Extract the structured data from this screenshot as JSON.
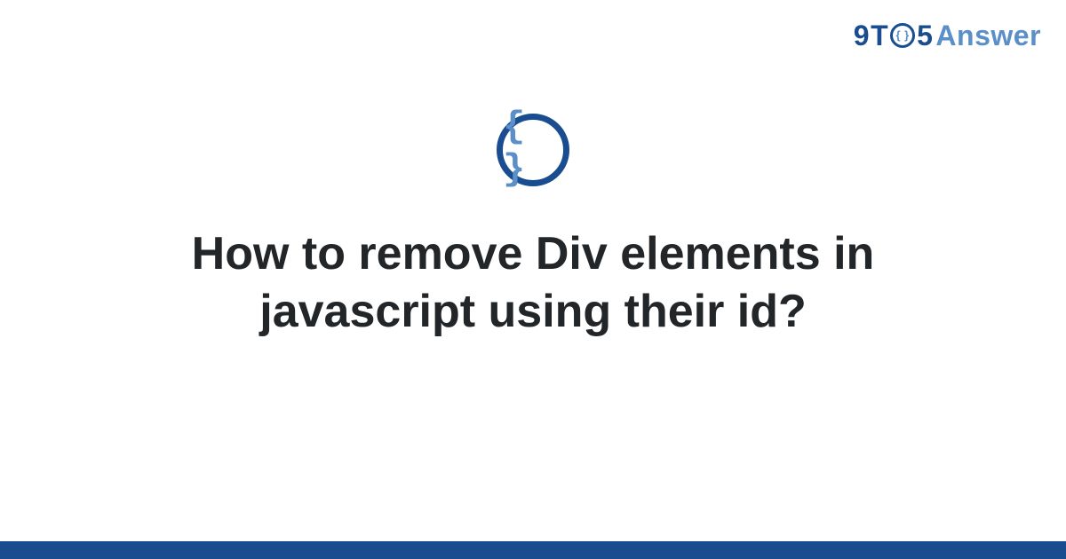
{
  "logo": {
    "nine": "9",
    "t": "T",
    "o_inner": "{ }",
    "five": "5",
    "answer": "Answer"
  },
  "icon": {
    "braces": "{ }"
  },
  "title": "How to remove Div elements in javascript using their id?",
  "colors": {
    "primary": "#1a4d8f",
    "accent": "#5b8fc7"
  }
}
